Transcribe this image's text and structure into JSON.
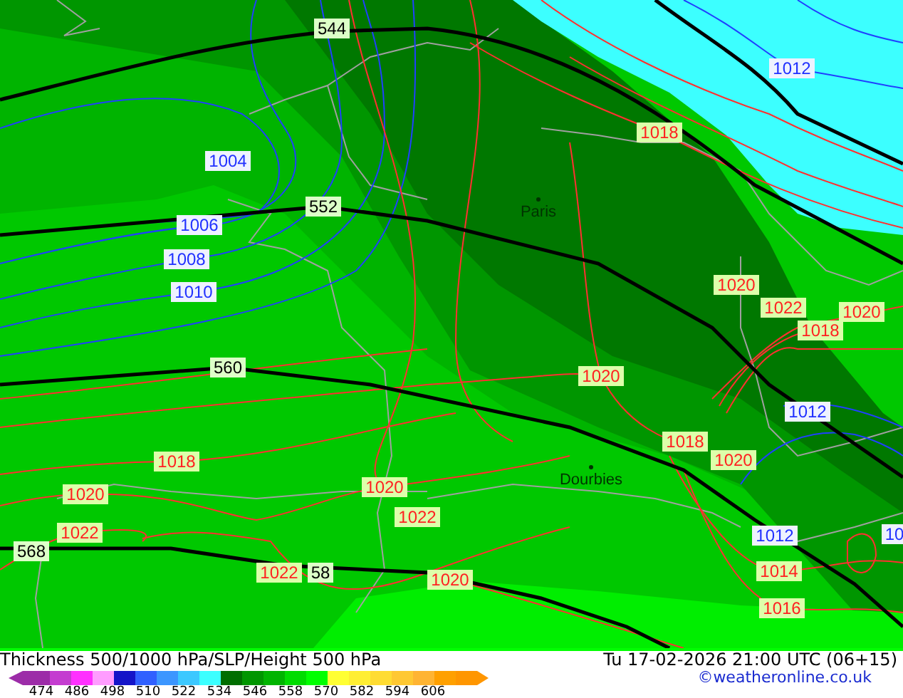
{
  "map": {
    "labels": [
      {
        "kind": "thickness",
        "text": "544"
      },
      {
        "kind": "thickness",
        "text": "552"
      },
      {
        "kind": "thickness",
        "text": "560"
      },
      {
        "kind": "thickness",
        "text": "568"
      },
      {
        "kind": "thickness",
        "text": "58"
      },
      {
        "kind": "isobar-blue",
        "text": "1004"
      },
      {
        "kind": "isobar-blue",
        "text": "1006"
      },
      {
        "kind": "isobar-blue",
        "text": "1008"
      },
      {
        "kind": "isobar-blue",
        "text": "1010"
      },
      {
        "kind": "isobar-blue",
        "text": "1012"
      },
      {
        "kind": "isobar-blue",
        "text": "1012"
      },
      {
        "kind": "isobar-blue",
        "text": "1012"
      },
      {
        "kind": "isobar-blue",
        "text": "10"
      },
      {
        "kind": "isobar-red",
        "text": "1018"
      },
      {
        "kind": "isobar-red",
        "text": "1020"
      },
      {
        "kind": "isobar-red",
        "text": "1022"
      },
      {
        "kind": "isobar-red",
        "text": "1020"
      },
      {
        "kind": "isobar-red",
        "text": "1018"
      },
      {
        "kind": "isobar-red",
        "text": "1020"
      },
      {
        "kind": "isobar-red",
        "text": "1018"
      },
      {
        "kind": "isobar-red",
        "text": "1020"
      },
      {
        "kind": "isobar-red",
        "text": "1018"
      },
      {
        "kind": "isobar-red",
        "text": "1020"
      },
      {
        "kind": "isobar-red",
        "text": "1020"
      },
      {
        "kind": "isobar-red",
        "text": "1022"
      },
      {
        "kind": "isobar-red",
        "text": "1022"
      },
      {
        "kind": "isobar-red",
        "text": "1022"
      },
      {
        "kind": "isobar-red",
        "text": "1020"
      },
      {
        "kind": "isobar-red",
        "text": "1014"
      },
      {
        "kind": "isobar-red",
        "text": "1016"
      },
      {
        "kind": "city",
        "text": "Paris"
      },
      {
        "kind": "city",
        "text": "Dourbies"
      }
    ]
  },
  "footer": {
    "title": "Thickness 500/1000 hPa/SLP/Height 500 hPa",
    "timestamp": "Tu 17-02-2026 21:00 UTC (06+15)",
    "copyright": "©weatheronline.co.uk",
    "legend_swatches": [
      {
        "color": "#9c2ca8"
      },
      {
        "color": "#c43cd0"
      },
      {
        "color": "#ff30ff"
      },
      {
        "color": "#ff9cff"
      },
      {
        "color": "#1414c8"
      },
      {
        "color": "#3060ff"
      },
      {
        "color": "#3c96ff"
      },
      {
        "color": "#3cc8ff"
      },
      {
        "color": "#3cffff"
      },
      {
        "color": "#006e00"
      },
      {
        "color": "#009600"
      },
      {
        "color": "#00b400"
      },
      {
        "color": "#00dc00"
      },
      {
        "color": "#00ff00"
      },
      {
        "color": "#ffff32"
      },
      {
        "color": "#ffee32"
      },
      {
        "color": "#ffdc32"
      },
      {
        "color": "#ffc832"
      },
      {
        "color": "#ffb432"
      },
      {
        "color": "#ffa000"
      },
      {
        "color": "#ff9600"
      }
    ],
    "legend_labels": [
      "474",
      "486",
      "498",
      "510",
      "522",
      "534",
      "546",
      "558",
      "570",
      "582",
      "594",
      "606"
    ]
  }
}
